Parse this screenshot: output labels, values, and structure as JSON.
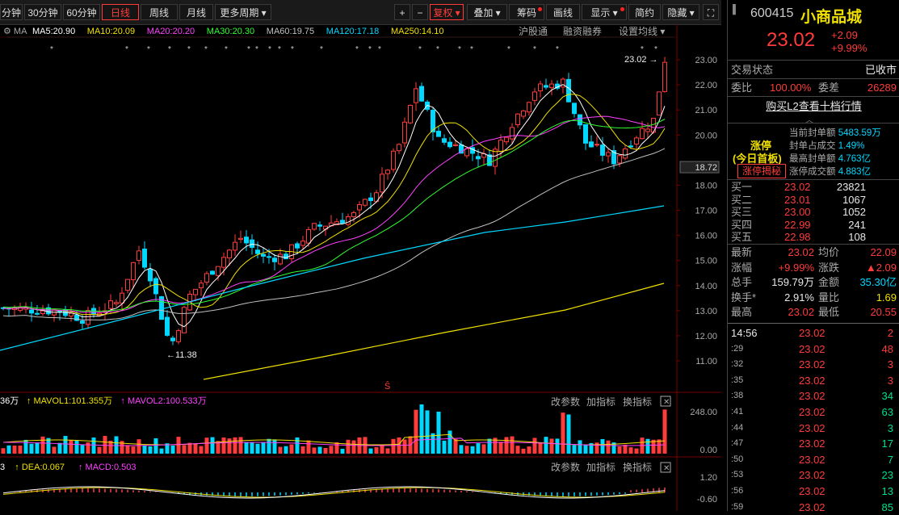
{
  "toolbar": {
    "left_tabs": [
      "分钟",
      "30分钟",
      "60分钟",
      "日线",
      "周线",
      "月线",
      "更多周期"
    ],
    "active_tab": "日线",
    "right_buttons": [
      "+",
      "−",
      "复权",
      "叠加",
      "筹码",
      "画线",
      "显示",
      "简约",
      "隐藏"
    ]
  },
  "ma_line": {
    "settings": "MA",
    "items": [
      {
        "label": "MA5:20.90",
        "color": "#ffffff"
      },
      {
        "label": "MA10:20.09",
        "color": "#f0e000"
      },
      {
        "label": "MA20:20.20",
        "color": "#ff40ff"
      },
      {
        "label": "MA30:20.30",
        "color": "#30ff30"
      },
      {
        "label": "MA60:19.75",
        "color": "#c0c0c0"
      },
      {
        "label": "MA120:17.18",
        "color": "#00d8ff"
      },
      {
        "label": "MA250:14.10",
        "color": "#f0e000"
      }
    ],
    "links": [
      "沪股通",
      "融资融券",
      "设置均线"
    ]
  },
  "price_axis": {
    "ticks": [
      "23.00",
      "22.00",
      "21.00",
      "20.00",
      "18.72",
      "18.00",
      "17.00",
      "16.00",
      "15.00",
      "14.00",
      "13.00",
      "12.00",
      "11.00"
    ],
    "current": "23.02",
    "low_label": "11.38"
  },
  "vol_panel": {
    "legend": [
      {
        "label": "36万",
        "color": "#ffffff"
      },
      {
        "label": "MAVOL1:101.355万",
        "color": "#f0e000"
      },
      {
        "label": "MAVOL2:100.533万",
        "color": "#ff40ff"
      }
    ],
    "buttons": [
      "改参数",
      "加指标",
      "换指标"
    ],
    "ticks": [
      "248.00",
      "0.00"
    ]
  },
  "macd_panel": {
    "legend": [
      {
        "label": "3",
        "color": "#ffffff"
      },
      {
        "label": "DEA:0.067",
        "color": "#f0e000"
      },
      {
        "label": "MACD:0.503",
        "color": "#ff40ff"
      }
    ],
    "buttons": [
      "改参数",
      "加指标",
      "换指标"
    ],
    "ticks": [
      "1.20",
      "-0.60"
    ]
  },
  "stock": {
    "code": "600415",
    "name": "小商品城",
    "price": "23.02",
    "change": "+2.09",
    "change_pct": "+9.99%"
  },
  "trade_status": {
    "label": "交易状态",
    "value": "已收市"
  },
  "wei_bi": {
    "label1": "委比",
    "value1": "100.00%",
    "label2": "委差",
    "value2": "26289"
  },
  "l2_link": "购买L2查看十档行情",
  "limit_up": {
    "title": "涨停",
    "subtitle": "(今日首板)",
    "button": "涨停揭秘",
    "rows": [
      {
        "label": "当前封单额",
        "value": "5483.59万"
      },
      {
        "label": "封单占成交",
        "value": "1.49%"
      },
      {
        "label": "最高封单额",
        "value": "4.763亿"
      },
      {
        "label": "涨停成交额",
        "value": "4.883亿"
      }
    ]
  },
  "order_book": [
    {
      "label": "买一",
      "price": "23.02",
      "vol": "23821"
    },
    {
      "label": "买二",
      "price": "23.01",
      "vol": "1067"
    },
    {
      "label": "买三",
      "price": "23.00",
      "vol": "1052"
    },
    {
      "label": "买四",
      "price": "22.99",
      "vol": "241"
    },
    {
      "label": "买五",
      "price": "22.98",
      "vol": "108"
    }
  ],
  "stats": [
    {
      "l1": "最新",
      "v1": "23.02",
      "l2": "均价",
      "v2": "22.09",
      "c1": "#ff3b3b",
      "c2": "#ff3b3b"
    },
    {
      "l1": "涨幅",
      "v1": "+9.99%",
      "l2": "涨跌",
      "v2": "▲2.09",
      "c1": "#ff3b3b",
      "c2": "#ff3b3b"
    },
    {
      "l1": "总手",
      "v1": "159.79万",
      "l2": "金额",
      "v2": "35.30亿",
      "c1": "#e8e8e8",
      "c2": "#00d8ff"
    },
    {
      "l1": "换手*",
      "v1": "2.91%",
      "l2": "量比",
      "v2": "1.69",
      "c1": "#e8e8e8",
      "c2": "#f0e000"
    },
    {
      "l1": "最高",
      "v1": "23.02",
      "l2": "最低",
      "v2": "20.55",
      "c1": "#ff3b3b",
      "c2": "#ff3b3b"
    }
  ],
  "ticks_list": [
    {
      "time": "14:56",
      "price": "23.02",
      "vol": "2",
      "vc": "#ff3b3b"
    },
    {
      "time": ":29",
      "price": "23.02",
      "vol": "48",
      "vc": "#ff3b3b"
    },
    {
      "time": ":32",
      "price": "23.02",
      "vol": "3",
      "vc": "#ff3b3b"
    },
    {
      "time": ":35",
      "price": "23.02",
      "vol": "3",
      "vc": "#ff3b3b"
    },
    {
      "time": ":38",
      "price": "23.02",
      "vol": "34",
      "vc": "#00e08a"
    },
    {
      "time": ":41",
      "price": "23.02",
      "vol": "63",
      "vc": "#00e08a"
    },
    {
      "time": ":44",
      "price": "23.02",
      "vol": "3",
      "vc": "#00e08a"
    },
    {
      "time": ":47",
      "price": "23.02",
      "vol": "17",
      "vc": "#00e08a"
    },
    {
      "time": ":50",
      "price": "23.02",
      "vol": "7",
      "vc": "#00e08a"
    },
    {
      "time": ":53",
      "price": "23.02",
      "vol": "23",
      "vc": "#00e08a"
    },
    {
      "time": ":56",
      "price": "23.02",
      "vol": "13",
      "vc": "#00e08a"
    },
    {
      "time": ":59",
      "price": "23.02",
      "vol": "85",
      "vc": "#00e08a"
    }
  ],
  "colors": {
    "up": "#ff3b3b",
    "down": "#00d8ff",
    "bg": "#000000"
  }
}
